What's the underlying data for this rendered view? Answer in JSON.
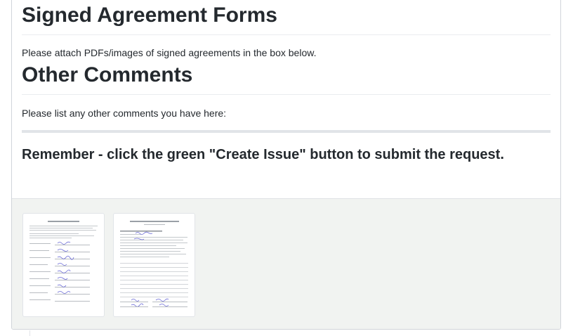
{
  "sections": {
    "signed": {
      "title": "Signed Agreement Forms",
      "note": "Please attach PDFs/images of signed agreements in the box below."
    },
    "other": {
      "title": "Other Comments",
      "note": "Please list any other comments you have here:"
    }
  },
  "reminder": "Remember - click the green \"Create Issue\" button to submit the request.",
  "attachments": [
    {
      "icon": "document-thumbnail-icon"
    },
    {
      "icon": "document-thumbnail-icon"
    }
  ],
  "colors": {
    "text": "#24292e",
    "border": "#d1d5da",
    "attachment_bg": "#f1f3f1",
    "handwriting": "#6b6bd6"
  }
}
